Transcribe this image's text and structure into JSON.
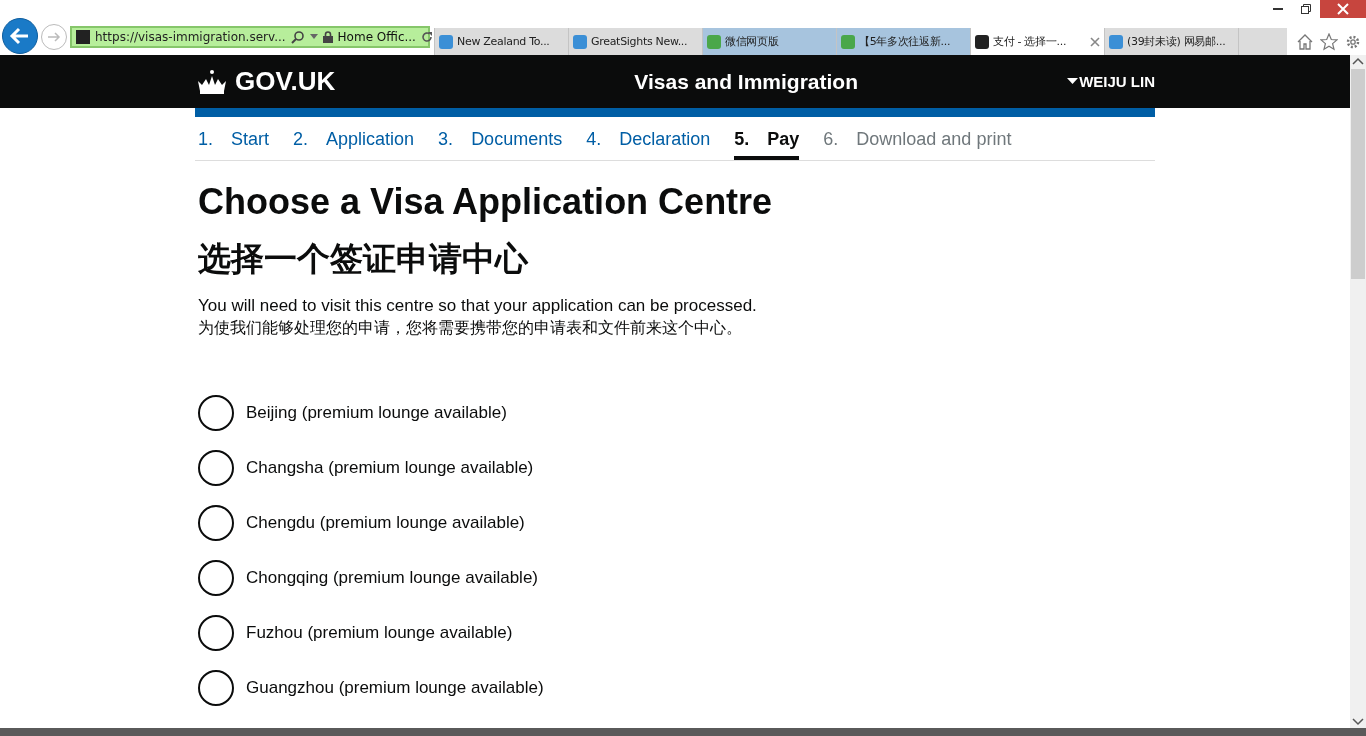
{
  "browser": {
    "address": "https://visas-immigration.serv...",
    "site_identity": "Home Offic...",
    "tabs": [
      {
        "label": "New Zealand To...",
        "selected": false,
        "kind": "plain"
      },
      {
        "label": "GreatSights New...",
        "selected": false,
        "kind": "plain"
      },
      {
        "label": "微信网页版",
        "selected": false,
        "kind": "pinned"
      },
      {
        "label": "【5年多次往返新...",
        "selected": false,
        "kind": "pinned"
      },
      {
        "label": "支付 - 选择一...",
        "selected": true,
        "kind": "plain"
      },
      {
        "label": "(39封未读) 网易邮...",
        "selected": false,
        "kind": "plain"
      }
    ]
  },
  "header": {
    "logo": "GOV.UK",
    "service": "Visas and Immigration",
    "user": "WEIJU LIN"
  },
  "steps": [
    {
      "number": "1.",
      "label": "Start",
      "selected": false,
      "disabled": false
    },
    {
      "number": "2.",
      "label": "Application",
      "selected": false,
      "disabled": false
    },
    {
      "number": "3.",
      "label": "Documents",
      "selected": false,
      "disabled": false
    },
    {
      "number": "4.",
      "label": "Declaration",
      "selected": false,
      "disabled": false
    },
    {
      "number": "5.",
      "label": "Pay",
      "selected": true,
      "disabled": false
    },
    {
      "number": "6.",
      "label": "Download and print",
      "selected": false,
      "disabled": true
    }
  ],
  "title": "Choose a Visa Application Centre",
  "title_zh": "选择一个签证申请中心",
  "intro": "You will need to visit this centre so that your application can be processed.",
  "intro_zh": "为使我们能够处理您的申请，您将需要携带您的申请表和文件前来这个中心。",
  "centres": [
    {
      "label": "Beijing (premium lounge available)",
      "selected": false
    },
    {
      "label": "Changsha (premium lounge available)",
      "selected": false
    },
    {
      "label": "Chengdu (premium lounge available)",
      "selected": false
    },
    {
      "label": "Chongqing (premium lounge available)",
      "selected": false
    },
    {
      "label": "Fuzhou (premium lounge available)",
      "selected": false
    },
    {
      "label": "Guangzhou (premium lounge available)",
      "selected": false
    }
  ]
}
